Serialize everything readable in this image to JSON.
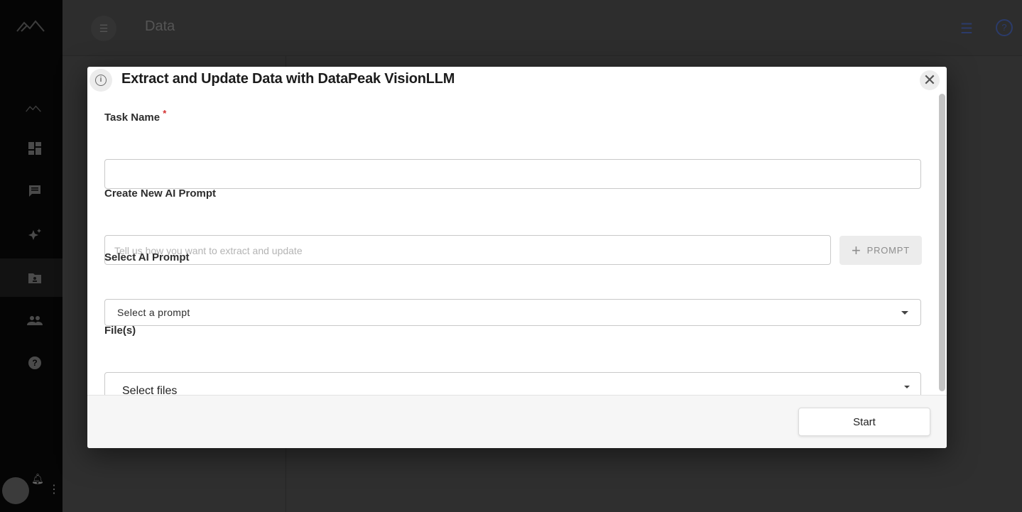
{
  "app": {
    "page_title": "Data",
    "sidebar": {
      "icons": [
        "logo-icon",
        "dashboard-icon",
        "chat-icon",
        "sparkle-icon",
        "folder-user-icon",
        "people-icon",
        "help-icon"
      ]
    }
  },
  "modal": {
    "title": "Extract and Update Data with DataPeak VisionLLM",
    "task_name": {
      "label": "Task Name",
      "required_marker": "*",
      "value": ""
    },
    "new_prompt": {
      "label": "Create New AI Prompt",
      "placeholder": "Tell us how you want to extract and update",
      "add_button_label": "PROMPT"
    },
    "select_prompt": {
      "label": "Select AI Prompt",
      "selected": "Select a prompt"
    },
    "files": {
      "label": "File(s)",
      "selected": "Select files"
    },
    "footer": {
      "start_label": "Start"
    }
  },
  "colors": {
    "required": "#d32f2f",
    "overlay": "#2f2f2f",
    "modal_bg": "#ffffff"
  }
}
